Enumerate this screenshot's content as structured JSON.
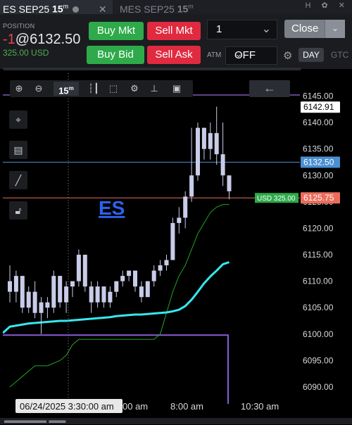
{
  "tabs": [
    {
      "symbol": "ES SEP25",
      "interval": "15",
      "sup": "m"
    },
    {
      "symbol": "MES SEP25",
      "interval": "15",
      "sup": "m"
    }
  ],
  "tab_icons": "H ✿ ✕",
  "position": {
    "label": "POSITION",
    "qty": "-1",
    "price": "@6132.50",
    "pnl": "325.00 USD"
  },
  "buttons": {
    "buy_mkt": "Buy Mkt",
    "sell_mkt": "Sell Mkt",
    "buy_bid": "Buy Bid",
    "sell_ask": "Sell Ask",
    "close": "Close"
  },
  "quantity": "1",
  "atm": {
    "label": "ATM",
    "value": "OFF"
  },
  "tif": {
    "selected": "DAY",
    "other": "GTC"
  },
  "toolbar": {
    "interval": "15",
    "interval_sup": "m"
  },
  "symbol_label": "ES",
  "crosshair_time": "06/24/2025 3:30:00 am",
  "colors": {
    "buy": "#2eaa4a",
    "sell": "#e02a40",
    "candle": "#c8cce8",
    "vwap": "#35e8f0",
    "trail": "#21a521",
    "last_price": "#ec6c5c",
    "entry": "#4a8fd0",
    "purple": "#8a5ad8"
  },
  "chart_data": {
    "type": "candlestick",
    "ylim": [
      6088,
      6146
    ],
    "y_ticks": [
      "6140.00",
      "6135.00",
      "6130.00",
      "6125.00",
      "6120.00",
      "6115.00",
      "6110.00",
      "6105.00",
      "6100.00",
      "6095.00",
      "6090.00"
    ],
    "y_tick_values": [
      6140,
      6135,
      6130,
      6125,
      6120,
      6115,
      6110,
      6105,
      6100,
      6095,
      6090
    ],
    "top_clipped_label": "6145.00",
    "x_labels": [
      "00 am",
      "8:00 am",
      "10:30 am"
    ],
    "price_tags": [
      {
        "text": "6142.91",
        "value": 6142.91,
        "kind": "high"
      },
      {
        "text": "6132.50",
        "value": 6132.5,
        "kind": "entry"
      },
      {
        "text": "6125.75",
        "value": 6125.75,
        "kind": "last"
      }
    ],
    "pnl_tag": "USD 325.00",
    "candles": [
      {
        "o": 6110,
        "h": 6113,
        "l": 6106,
        "c": 6108
      },
      {
        "o": 6108,
        "h": 6112,
        "l": 6106,
        "c": 6111
      },
      {
        "o": 6111,
        "h": 6111,
        "l": 6104,
        "c": 6105
      },
      {
        "o": 6105,
        "h": 6109,
        "l": 6104,
        "c": 6108
      },
      {
        "o": 6108,
        "h": 6110,
        "l": 6103,
        "c": 6104
      },
      {
        "o": 6104,
        "h": 6107,
        "l": 6100,
        "c": 6106
      },
      {
        "o": 6106,
        "h": 6107,
        "l": 6103,
        "c": 6105
      },
      {
        "o": 6105,
        "h": 6112,
        "l": 6104,
        "c": 6111
      },
      {
        "o": 6111,
        "h": 6111,
        "l": 6105,
        "c": 6106
      },
      {
        "o": 6106,
        "h": 6110,
        "l": 6104,
        "c": 6109
      },
      {
        "o": 6109,
        "h": 6110,
        "l": 6107,
        "c": 6110
      },
      {
        "o": 6110,
        "h": 6116,
        "l": 6109,
        "c": 6115
      },
      {
        "o": 6115,
        "h": 6115,
        "l": 6108,
        "c": 6109
      },
      {
        "o": 6109,
        "h": 6110,
        "l": 6104,
        "c": 6106
      },
      {
        "o": 6106,
        "h": 6110,
        "l": 6105,
        "c": 6109
      },
      {
        "o": 6109,
        "h": 6109,
        "l": 6105,
        "c": 6106
      },
      {
        "o": 6106,
        "h": 6109,
        "l": 6105,
        "c": 6108
      },
      {
        "o": 6108,
        "h": 6110,
        "l": 6107,
        "c": 6110
      },
      {
        "o": 6110,
        "h": 6112,
        "l": 6109,
        "c": 6111
      },
      {
        "o": 6111,
        "h": 6112,
        "l": 6110,
        "c": 6112
      },
      {
        "o": 6112,
        "h": 6112,
        "l": 6108,
        "c": 6109
      },
      {
        "o": 6109,
        "h": 6110,
        "l": 6106,
        "c": 6107
      },
      {
        "o": 6107,
        "h": 6110,
        "l": 6107,
        "c": 6110
      },
      {
        "o": 6110,
        "h": 6113,
        "l": 6109,
        "c": 6112
      },
      {
        "o": 6112,
        "h": 6114,
        "l": 6111,
        "c": 6113
      },
      {
        "o": 6113,
        "h": 6115,
        "l": 6112,
        "c": 6114
      },
      {
        "o": 6114,
        "h": 6122,
        "l": 6114,
        "c": 6121
      },
      {
        "o": 6121,
        "h": 6124,
        "l": 6119,
        "c": 6122
      },
      {
        "o": 6122,
        "h": 6127,
        "l": 6120,
        "c": 6126
      },
      {
        "o": 6126,
        "h": 6139,
        "l": 6125,
        "c": 6130
      },
      {
        "o": 6130,
        "h": 6140,
        "l": 6129,
        "c": 6139
      },
      {
        "o": 6139,
        "h": 6139,
        "l": 6133,
        "c": 6135
      },
      {
        "o": 6135,
        "h": 6140,
        "l": 6133,
        "c": 6138
      },
      {
        "o": 6138,
        "h": 6143,
        "l": 6132,
        "c": 6134
      },
      {
        "o": 6134,
        "h": 6140,
        "l": 6128,
        "c": 6130
      },
      {
        "o": 6130,
        "h": 6130,
        "l": 6125.5,
        "c": 6127
      }
    ],
    "vwap": [
      6101.4,
      6101.6,
      6101.8,
      6102.0,
      6102.1,
      6102.2,
      6102.3,
      6102.4,
      6102.5,
      6102.5,
      6102.6,
      6102.7,
      6102.8,
      6102.9,
      6103.0,
      6103.1,
      6103.2,
      6103.4,
      6103.5,
      6103.6,
      6103.7,
      6103.7,
      6103.8,
      6103.9,
      6104.0,
      6104.1,
      6104.3,
      6104.6,
      6105.3,
      6106.5,
      6108.0,
      6109.6,
      6110.9,
      6112.0,
      6113.2,
      6113.6
    ],
    "trail_stop": [
      6090,
      6091,
      6092,
      6093,
      6094,
      6094,
      6094,
      6094.5,
      6095,
      6096,
      6098,
      6099,
      6099,
      6099,
      6099,
      6099,
      6099,
      6099,
      6099,
      6099,
      6099,
      6099,
      6099,
      6099,
      6100,
      6104,
      6108,
      6111,
      6113,
      6116,
      6119,
      6121,
      6123,
      6124,
      6124.5,
      6124.5
    ],
    "purple_level": 6099.8
  }
}
